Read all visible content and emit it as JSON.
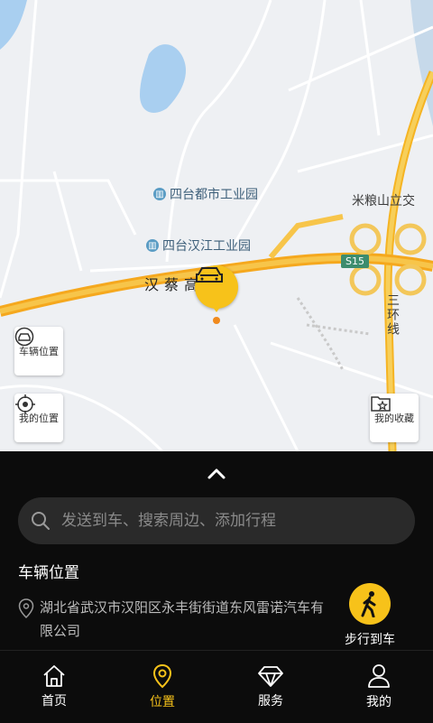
{
  "map": {
    "labels": {
      "mili_mountain": "米粮山立交",
      "third_ring": "三环线",
      "expressway": "汉蔡高速",
      "route_badge": "S15"
    },
    "pois": [
      {
        "name": "四台都市工业园"
      },
      {
        "name": "四台汉江工业园"
      }
    ],
    "buttons": {
      "vehicle_position": "车辆位置",
      "my_position": "我的位置",
      "my_favorites": "我的收藏"
    }
  },
  "panel": {
    "search": {
      "placeholder": "发送到车、搜索周边、添加行程"
    },
    "section_title": "车辆位置",
    "address": "湖北省武汉市汉阳区永丰街街道东风雷诺汽车有限公司",
    "walk_button": "步行到车"
  },
  "tabs": [
    {
      "label": "首页",
      "icon": "home-icon"
    },
    {
      "label": "位置",
      "icon": "location-pin-icon",
      "active": true
    },
    {
      "label": "服务",
      "icon": "diamond-icon"
    },
    {
      "label": "我的",
      "icon": "person-icon"
    }
  ],
  "colors": {
    "accent": "#f7c21a",
    "panel_bg": "#0c0c0c"
  }
}
